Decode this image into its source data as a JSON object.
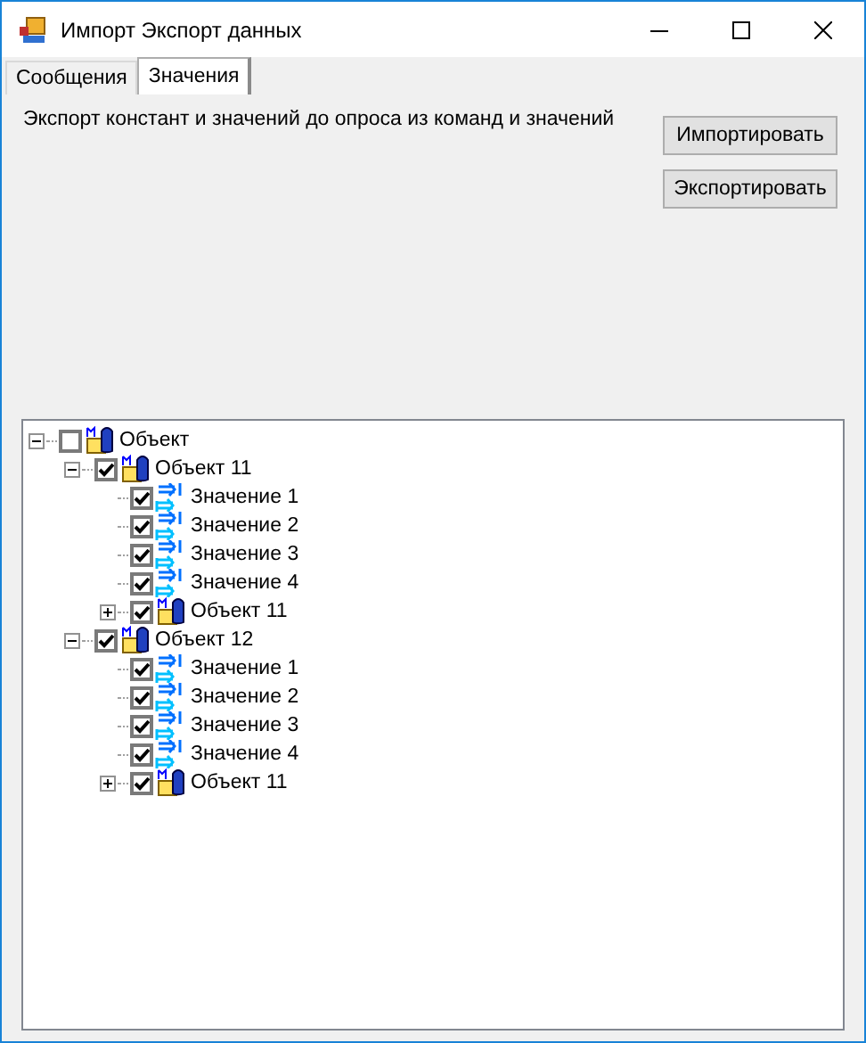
{
  "window": {
    "title": "Импорт Экспорт данных"
  },
  "tabs": [
    {
      "label": "Сообщения",
      "selected": false
    },
    {
      "label": "Значения",
      "selected": true
    }
  ],
  "description": "Экспорт констант и значений до опроса из команд и значений",
  "buttons": [
    "Импортировать",
    "Экспортировать"
  ],
  "tree": [
    {
      "kind": "object",
      "label": "Объект",
      "checked": false,
      "expanded": true,
      "children": [
        {
          "kind": "object",
          "label": "Объект 11",
          "checked": true,
          "expanded": true,
          "children": [
            {
              "kind": "value",
              "label": "Значение 1",
              "checked": true
            },
            {
              "kind": "value",
              "label": "Значение 2",
              "checked": true
            },
            {
              "kind": "value",
              "label": "Значение 3",
              "checked": true
            },
            {
              "kind": "value",
              "label": "Значение 4",
              "checked": true
            },
            {
              "kind": "object",
              "label": "Объект 11",
              "checked": true,
              "expanded": false
            }
          ]
        },
        {
          "kind": "object",
          "label": "Объект 12",
          "checked": true,
          "expanded": true,
          "children": [
            {
              "kind": "value",
              "label": "Значение 1",
              "checked": true
            },
            {
              "kind": "value",
              "label": "Значение 2",
              "checked": true
            },
            {
              "kind": "value",
              "label": "Значение 3",
              "checked": true
            },
            {
              "kind": "value",
              "label": "Значение 4",
              "checked": true
            },
            {
              "kind": "object",
              "label": "Объект 11",
              "checked": true,
              "expanded": false
            }
          ]
        }
      ]
    }
  ]
}
